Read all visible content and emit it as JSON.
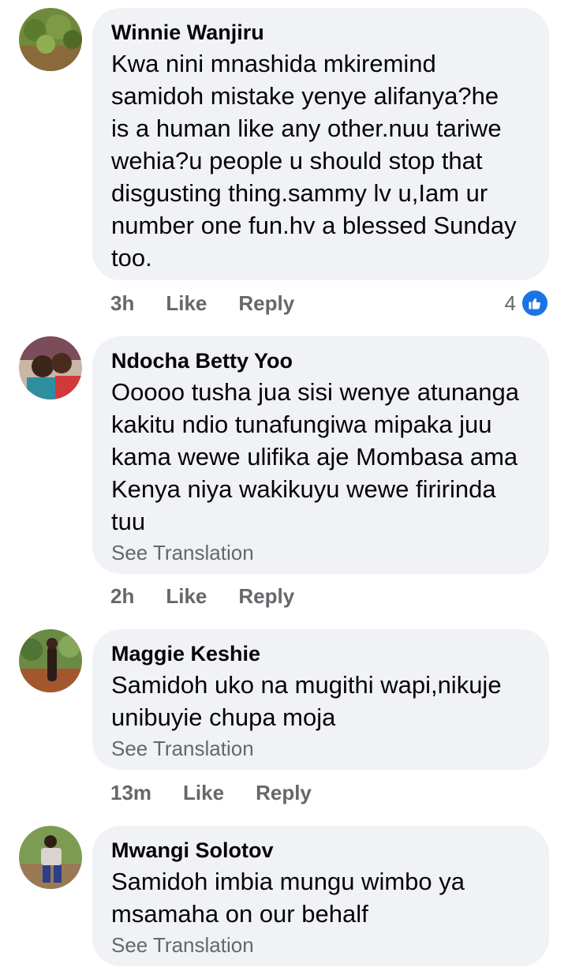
{
  "comments": [
    {
      "author": "Winnie Wanjiru",
      "text": "Kwa nini mnashida mkiremind\nsamidoh mistake yenye alifanya?he\nis a human like any other.nuu tariwe\nwehia?u people u should stop that\ndisgusting thing.sammy lv u,Iam ur\nnumber one fun.hv a blessed Sunday\ntoo.",
      "time": "3h",
      "like": "Like",
      "reply": "Reply",
      "reaction_count": "4"
    },
    {
      "author": "Ndocha Betty Yoo",
      "text": "Ooooo tusha jua sisi wenye atunanga\nkakitu ndio tunafungiwa mipaka juu\nkama wewe ulifika aje Mombasa ama\nKenya niya wakikuyu wewe firirinda\ntuu",
      "see_translation": "See Translation",
      "time": "2h",
      "like": "Like",
      "reply": "Reply"
    },
    {
      "author": "Maggie Keshie",
      "text": "Samidoh uko na mugithi wapi,nikuje\nunibuyie chupa moja",
      "see_translation": "See Translation",
      "time": "13m",
      "like": "Like",
      "reply": "Reply"
    },
    {
      "author": "Mwangi Solotov",
      "text": "Samidoh imbia mungu wimbo ya\nmsamaha on our behalf",
      "see_translation": "See Translation"
    }
  ],
  "colors": {
    "bubble": "#f0f2f5",
    "meta_text": "#65676b",
    "like_blue": "#1b74e4"
  },
  "icons": {
    "reaction": "thumbs-up-icon"
  }
}
